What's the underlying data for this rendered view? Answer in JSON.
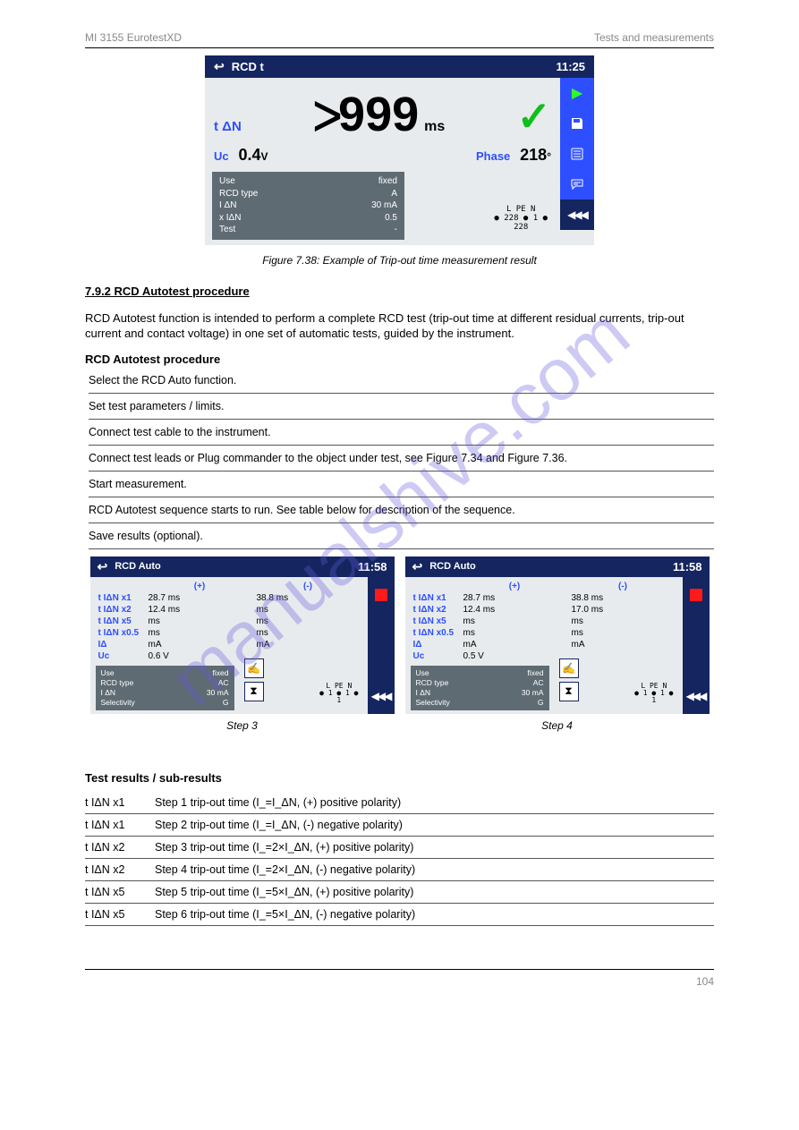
{
  "header": {
    "left": "MI 3155 EurotestXD",
    "right": "Tests and measurements"
  },
  "watermark": "manualshive.com",
  "fig1": {
    "title": "RCD t",
    "time": "11:25",
    "label_t": "t ΔN",
    "gt": "ᐳ",
    "big": "999",
    "big_unit": "ms",
    "uc_label": "Uc",
    "uc_val": "0.4",
    "uc_unit": "V",
    "phase_label": "Phase",
    "phase_val": "218",
    "phase_unit": "°",
    "params": [
      {
        "k": "Use",
        "v": "fixed"
      },
      {
        "k": "RCD type",
        "v": "A"
      },
      {
        "k": "I ΔN",
        "v": "30 mA"
      },
      {
        "k": "x IΔN",
        "v": "0.5"
      },
      {
        "k": "Test",
        "v": "-"
      }
    ],
    "wires_top": "L     PE    N",
    "wires_mid": "● 228 ●  1  ●",
    "wires_bot": "   228",
    "caption": "Figure 7.38: Example of Trip-out time measurement result"
  },
  "section_title": "7.9.2  RCD Autotest procedure",
  "section_intro": "RCD Autotest function is intended to perform a complete RCD test (trip-out time at different residual currents, trip-out current and contact voltage) in one set of automatic tests, guided by the instrument.",
  "steps_title": "RCD Autotest procedure",
  "steps": [
    "Select the RCD Auto function.",
    "Set test parameters / limits.",
    "Connect test cable to the instrument.",
    "Connect test leads or Plug commander to the object under test, see Figure 7.34 and Figure 7.36.",
    "Start measurement.",
    "RCD Autotest sequence starts to run. See table below for description of the sequence.",
    "Save results (optional)."
  ],
  "fig2": {
    "title": "RCD Auto",
    "time": "11:58",
    "col1": "(+)",
    "col2": "(-)",
    "left": {
      "rows": [
        {
          "lbl": "t IΔN x1",
          "v1": "28.7 ms",
          "v2": "38.8 ms"
        },
        {
          "lbl": "t IΔN x2",
          "v1": "12.4 ms",
          "v2": "ms"
        },
        {
          "lbl": "t IΔN x5",
          "v1": "ms",
          "v2": "ms"
        },
        {
          "lbl": "t IΔN x0.5",
          "v1": "ms",
          "v2": "ms"
        },
        {
          "lbl": "IΔ",
          "v1": "mA",
          "v2": "mA"
        },
        {
          "lbl": "Uc",
          "v1": "0.6 V",
          "v2": ""
        }
      ],
      "params": [
        {
          "k": "Use",
          "v": "fixed"
        },
        {
          "k": "RCD type",
          "v": "AC"
        },
        {
          "k": "I ΔN",
          "v": "30 mA"
        },
        {
          "k": "Selectivity",
          "v": "G"
        }
      ]
    },
    "right": {
      "rows": [
        {
          "lbl": "t IΔN x1",
          "v1": "28.7 ms",
          "v2": "38.8 ms"
        },
        {
          "lbl": "t IΔN x2",
          "v1": "12.4 ms",
          "v2": "17.0 ms"
        },
        {
          "lbl": "t IΔN x5",
          "v1": "ms",
          "v2": "ms"
        },
        {
          "lbl": "t IΔN x0.5",
          "v1": "ms",
          "v2": "ms"
        },
        {
          "lbl": "IΔ",
          "v1": "mA",
          "v2": "mA"
        },
        {
          "lbl": "Uc",
          "v1": "0.5 V",
          "v2": ""
        }
      ],
      "params": [
        {
          "k": "Use",
          "v": "fixed"
        },
        {
          "k": "RCD type",
          "v": "AC"
        },
        {
          "k": "I ΔN",
          "v": "30 mA"
        },
        {
          "k": "Selectivity",
          "v": "G"
        }
      ]
    },
    "wires_top": "L   PE   N",
    "wires_mid": "●  1 ●  1 ●",
    "wires_bot": "     1",
    "caption": "Step 3",
    "caption2": "Step 4"
  },
  "results_title": "Test results / sub-results",
  "results": [
    {
      "k": "t IΔN x1",
      "v": "Step 1 trip-out time (I_=I_ΔN, (+) positive polarity)"
    },
    {
      "k": "t IΔN x1",
      "v": "Step 2 trip-out time (I_=I_ΔN, (-) negative polarity)"
    },
    {
      "k": "t IΔN x2",
      "v": "Step 3 trip-out time (I_=2×I_ΔN, (+) positive polarity)"
    },
    {
      "k": "t IΔN x2",
      "v": "Step 4 trip-out time (I_=2×I_ΔN, (-) negative polarity)"
    },
    {
      "k": "t IΔN x5",
      "v": "Step 5 trip-out time (I_=5×I_ΔN, (+) positive polarity)"
    },
    {
      "k": "t IΔN x5",
      "v": "Step 6 trip-out time (I_=5×I_ΔN, (-) negative polarity)"
    }
  ],
  "footer": "104"
}
